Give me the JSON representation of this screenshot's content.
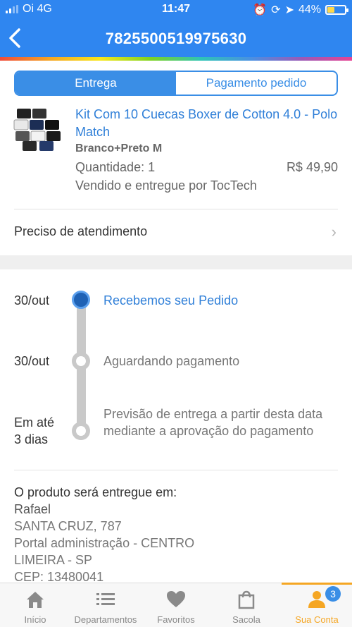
{
  "status_bar": {
    "carrier": "Oi 4G",
    "time": "11:47",
    "battery": "44%"
  },
  "header": {
    "order_id": "7825500519975630"
  },
  "tabs": [
    {
      "label": "Entrega",
      "active": true
    },
    {
      "label": "Pagamento pedido",
      "active": false
    }
  ],
  "product": {
    "title": "Kit Com 10 Cuecas Boxer de Cotton 4.0 - Polo Match",
    "variant": "Branco+Preto M",
    "quantity": "Quantidade: 1",
    "price": "R$ 49,90",
    "seller": "Vendido e entregue por TocTech"
  },
  "help": {
    "label": "Preciso de atendimento"
  },
  "timeline": [
    {
      "date": "30/out",
      "text": "Recebemos seu Pedido",
      "active": true
    },
    {
      "date": "30/out",
      "text": "Aguardando pagamento",
      "active": false
    },
    {
      "date": "Em até 3 dias",
      "text": "Previsão de entrega a partir desta data mediante a aprovação do pagamento",
      "active": false
    }
  ],
  "address": {
    "heading": "O produto será entregue em:",
    "name": "Rafael",
    "street": "SANTA CRUZ, 787",
    "complement": "Portal administração - CENTRO",
    "city": "LIMEIRA - SP",
    "cep": "CEP: 13480041"
  },
  "bottom_nav": [
    {
      "label": "Início",
      "icon": "home-icon"
    },
    {
      "label": "Departamentos",
      "icon": "list-icon"
    },
    {
      "label": "Favoritos",
      "icon": "heart-icon"
    },
    {
      "label": "Sacola",
      "icon": "bag-icon"
    },
    {
      "label": "Sua Conta",
      "icon": "user-icon",
      "active": true,
      "badge": "3"
    }
  ],
  "colors": {
    "header": "#2f86f0",
    "accent": "#3a8ee6",
    "active_nav": "#f5a623"
  }
}
